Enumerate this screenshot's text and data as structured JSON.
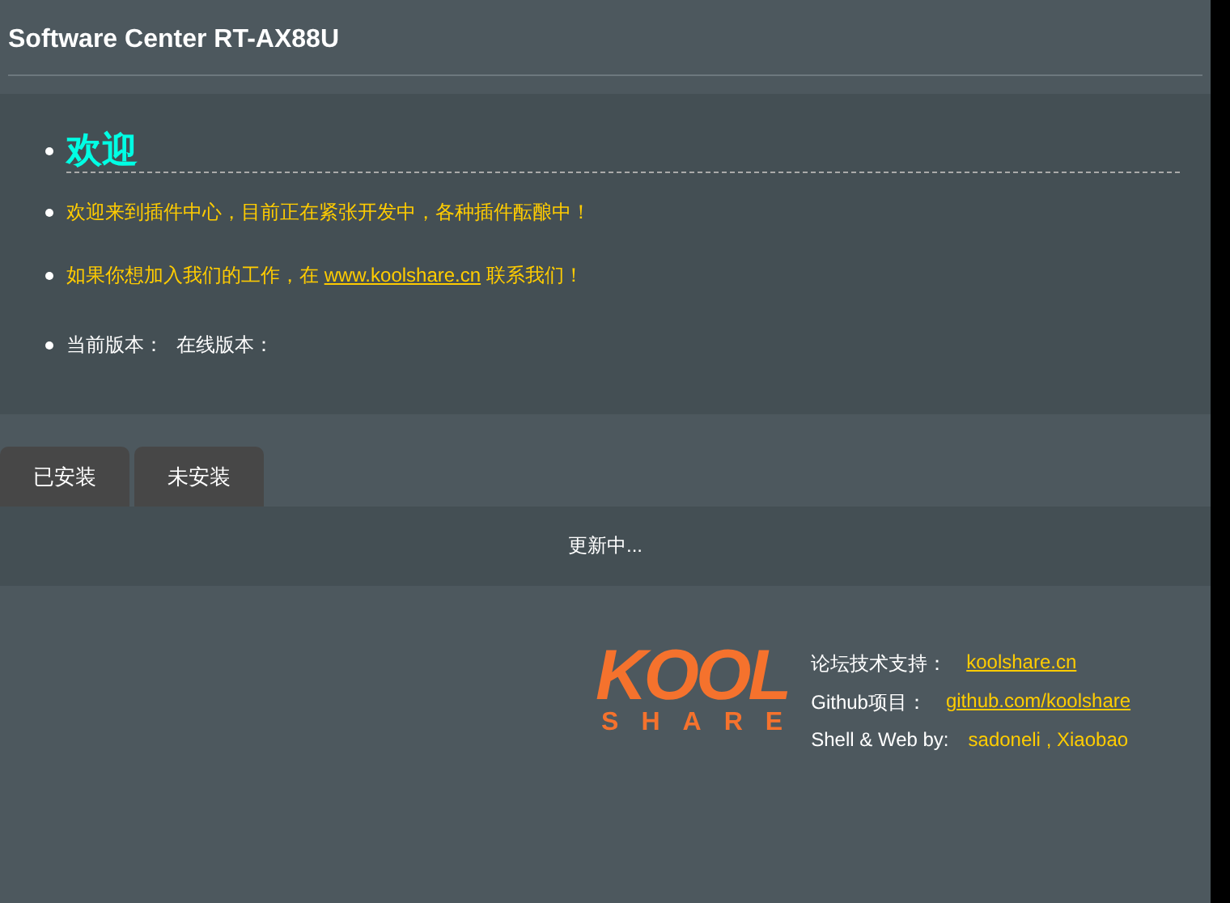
{
  "header": {
    "title": "Software Center RT-AX88U"
  },
  "intro": {
    "heading": "欢迎",
    "lines": [
      {
        "kind": "text",
        "text": "欢迎来到插件中心，目前正在紧张开发中，各种插件酝酿中！"
      },
      {
        "kind": "link",
        "before": "如果你想加入我们的工作，在 ",
        "link": "www.koolshare.cn",
        "after": " 联系我们！"
      },
      {
        "kind": "versions",
        "parts": [
          "当前版本：",
          "在线版本："
        ]
      }
    ]
  },
  "tabs": [
    {
      "label": "已安装"
    },
    {
      "label": "未安装"
    }
  ],
  "status": "更新中...",
  "footer": {
    "logo": {
      "top": "KOOL",
      "bottom": "SHARE"
    },
    "rows": [
      {
        "label": "论坛技术支持：",
        "links": [
          "koolshare.cn"
        ],
        "underline": true
      },
      {
        "label": "Github项目：",
        "links": [
          "github.com/koolshare"
        ],
        "underline": true
      },
      {
        "label": "Shell & Web by:",
        "links": [
          "sadoneli",
          "Xiaobao"
        ],
        "separator": ",",
        "underline": false
      }
    ]
  }
}
